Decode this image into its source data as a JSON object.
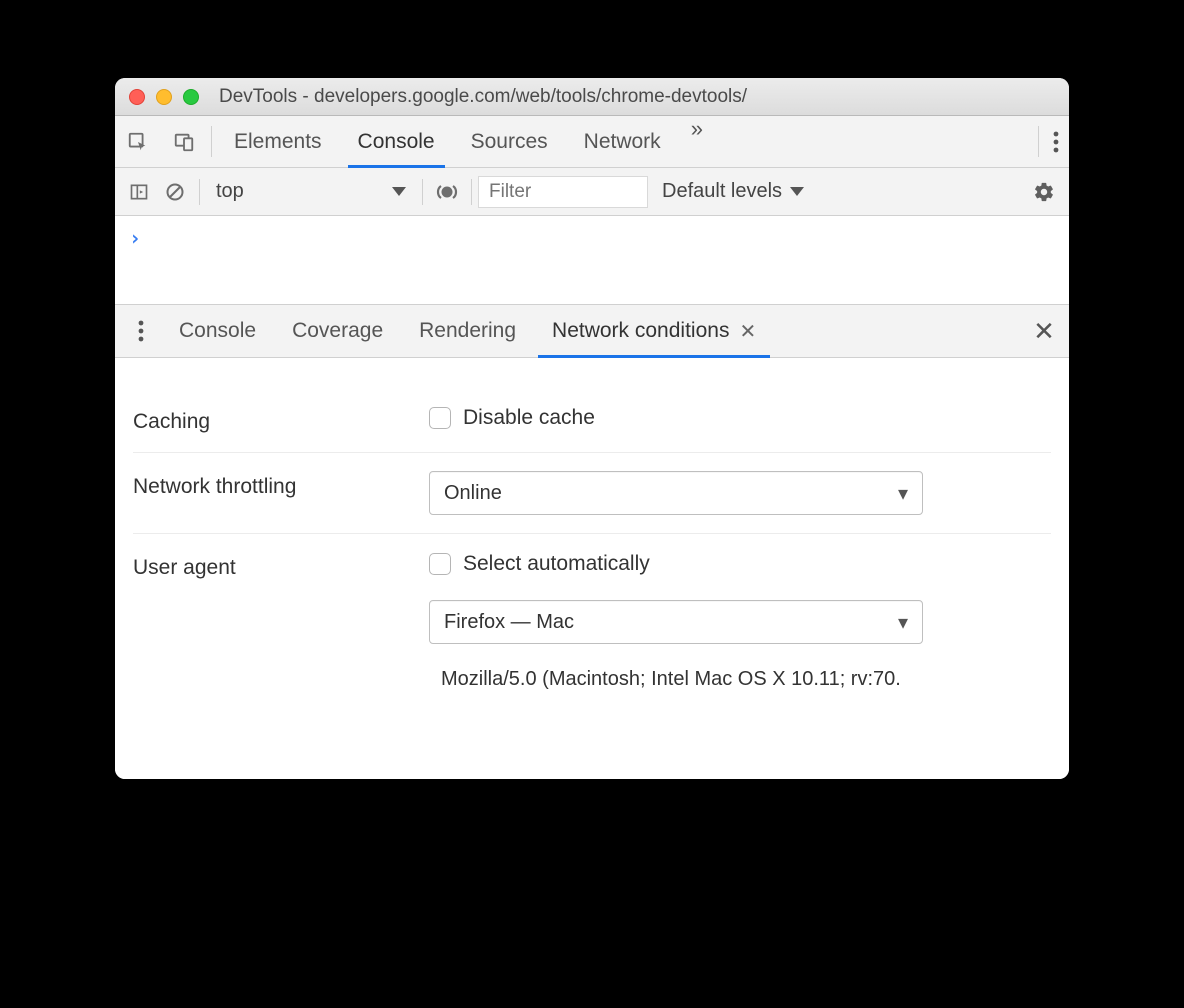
{
  "window": {
    "title": "DevTools - developers.google.com/web/tools/chrome-devtools/"
  },
  "tabs": {
    "items": [
      "Elements",
      "Console",
      "Sources",
      "Network"
    ],
    "active": "Console"
  },
  "console_toolbar": {
    "context": "top",
    "filter_placeholder": "Filter",
    "levels": "Default levels"
  },
  "drawer": {
    "tabs": [
      "Console",
      "Coverage",
      "Rendering",
      "Network conditions"
    ],
    "active": "Network conditions"
  },
  "network_conditions": {
    "caching": {
      "label": "Caching",
      "checkbox_label": "Disable cache"
    },
    "throttling": {
      "label": "Network throttling",
      "value": "Online"
    },
    "user_agent": {
      "label": "User agent",
      "checkbox_label": "Select automatically",
      "select_value": "Firefox — Mac",
      "ua_string": "Mozilla/5.0 (Macintosh; Intel Mac OS X 10.11; rv:70."
    }
  }
}
